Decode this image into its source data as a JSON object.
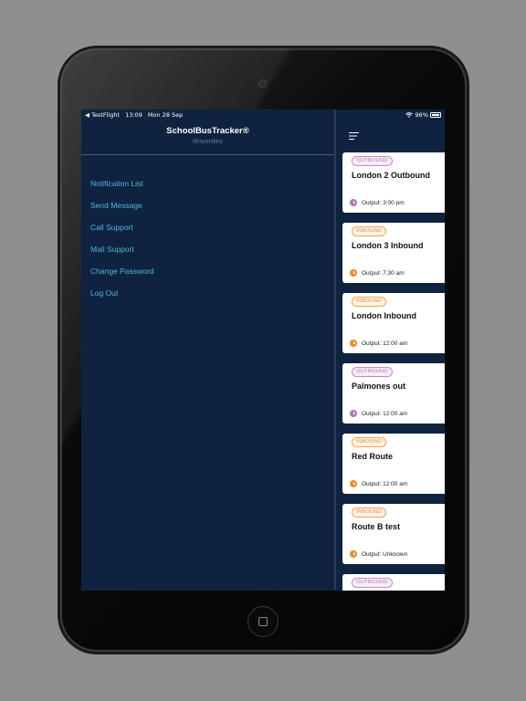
{
  "status_bar": {
    "back_app": "◀ TestFlight",
    "time": "13:09",
    "date": "Mon 28 Sep",
    "battery": "96%"
  },
  "sidebar": {
    "title": "SchoolBusTracker®",
    "subtitle": "driverdev",
    "items": [
      {
        "label": "Notification List"
      },
      {
        "label": "Send Message"
      },
      {
        "label": "Call Support"
      },
      {
        "label": "Mail Support"
      },
      {
        "label": "Change Password"
      },
      {
        "label": "Log Out"
      }
    ]
  },
  "routes": [
    {
      "badge": "OUTBOUND",
      "type": "out",
      "name": "London 2 Outbound",
      "time": "Output: 3:00 pm"
    },
    {
      "badge": "INBOUND",
      "type": "in",
      "name": "London 3 Inbound",
      "time": "Output: 7:30 am"
    },
    {
      "badge": "INBOUND",
      "type": "in",
      "name": "London Inbound",
      "time": "Output: 12:00 am"
    },
    {
      "badge": "OUTBOUND",
      "type": "out",
      "name": "Palmones out",
      "time": "Output: 12:00 am"
    },
    {
      "badge": "INBOUND",
      "type": "in",
      "name": "Red Route",
      "time": "Output: 12:00 am"
    },
    {
      "badge": "INBOUND",
      "type": "in",
      "name": "Route B test",
      "time": "Output: Unknown"
    },
    {
      "badge": "OUTBOUND",
      "type": "out",
      "name": "",
      "time": ""
    }
  ],
  "colors": {
    "background": "#0f2340",
    "menu_text": "#4fb7db",
    "outbound": "#b07ab0",
    "inbound": "#e98c30"
  },
  "battery_level": 0.96
}
